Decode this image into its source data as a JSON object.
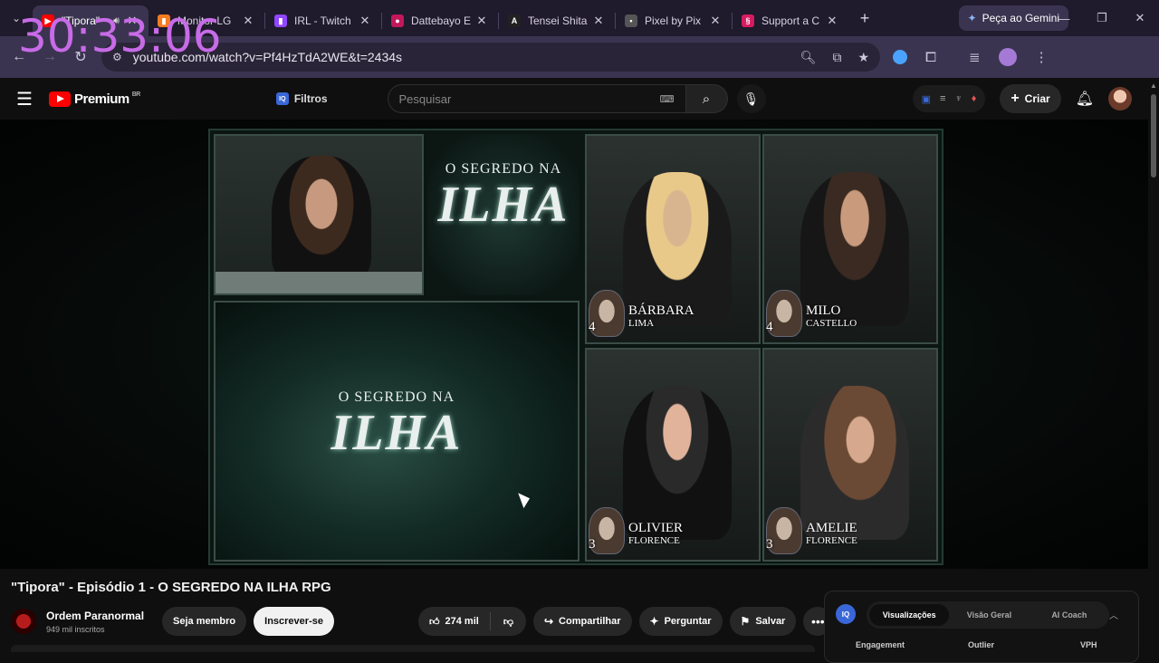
{
  "overlay": {
    "timer": "30:33:06"
  },
  "browser": {
    "tabs": [
      {
        "title": "\"Tipora\"",
        "color": "#ff0000",
        "glyph": "▶",
        "active": true,
        "audio": true
      },
      {
        "title": "Monitor LG",
        "color": "#f47b20",
        "glyph": "▮"
      },
      {
        "title": "IRL - Twitch",
        "color": "#9146ff",
        "glyph": "▮"
      },
      {
        "title": "Dattebayo E",
        "color": "#c2185b",
        "glyph": "●"
      },
      {
        "title": "Tensei Shita",
        "color": "#222222",
        "glyph": "A"
      },
      {
        "title": "Pixel by Pix",
        "color": "#555555",
        "glyph": "•"
      },
      {
        "title": "Support a C",
        "color": "#d81b60",
        "glyph": "§"
      }
    ],
    "gemini_label": "Peça ao Gemini",
    "url": "youtube.com/watch?v=Pf4HzTdA2WE&t=2434s"
  },
  "youtube": {
    "logo_text": "Premium",
    "logo_region": "BR",
    "filtros_label": "Filtros",
    "search_placeholder": "Pesquisar",
    "create_label": "Criar",
    "video": {
      "logo_line1": "O SEGREDO NA",
      "logo_line2": "ILHA",
      "players": [
        {
          "first": "Bárbara",
          "last": "Lima",
          "level": "4"
        },
        {
          "first": "Milo",
          "last": "Castello",
          "level": "4"
        },
        {
          "first": "Olivier",
          "last": "Florence",
          "level": "3"
        },
        {
          "first": "Amelie",
          "last": "Florence",
          "level": "3"
        }
      ]
    },
    "title": "\"Tipora\" - Episódio 1 - O SEGREDO NA ILHA RPG",
    "channel": {
      "name": "Ordem Paranormal",
      "subscribers": "949 mil inscritos"
    },
    "member_label": "Seja membro",
    "subscribe_label": "Inscrever-se",
    "likes": "274 mil",
    "share_label": "Compartilhar",
    "ask_label": "Perguntar",
    "save_label": "Salvar",
    "iq_panel": {
      "badge": "IQ",
      "tabs": [
        "Visualizações",
        "Visão Geral",
        "AI Coach"
      ],
      "columns": [
        "Engagement",
        "Outlier",
        "VPH"
      ]
    }
  }
}
